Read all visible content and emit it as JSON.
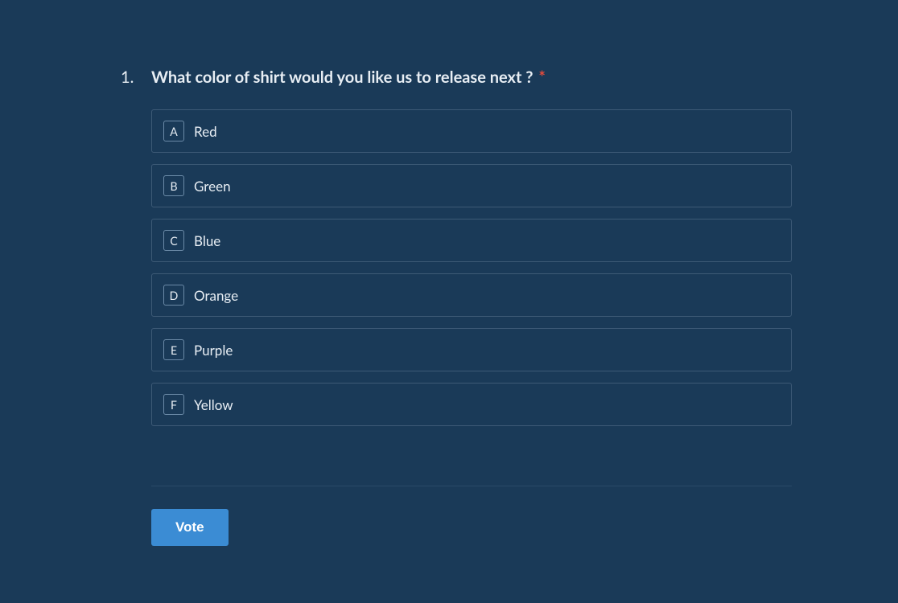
{
  "question": {
    "number": "1.",
    "text": "What color of shirt would you like us to release next ?",
    "required": true,
    "required_mark": "*",
    "options": [
      {
        "key": "A",
        "label": "Red"
      },
      {
        "key": "B",
        "label": "Green"
      },
      {
        "key": "C",
        "label": "Blue"
      },
      {
        "key": "D",
        "label": "Orange"
      },
      {
        "key": "E",
        "label": "Purple"
      },
      {
        "key": "F",
        "label": "Yellow"
      }
    ]
  },
  "actions": {
    "vote_label": "Vote"
  },
  "colors": {
    "background": "#1a3a58",
    "text": "#e8eef4",
    "border": "#3d5a76",
    "accent": "#3b8cd4",
    "required": "#e74c3c"
  }
}
